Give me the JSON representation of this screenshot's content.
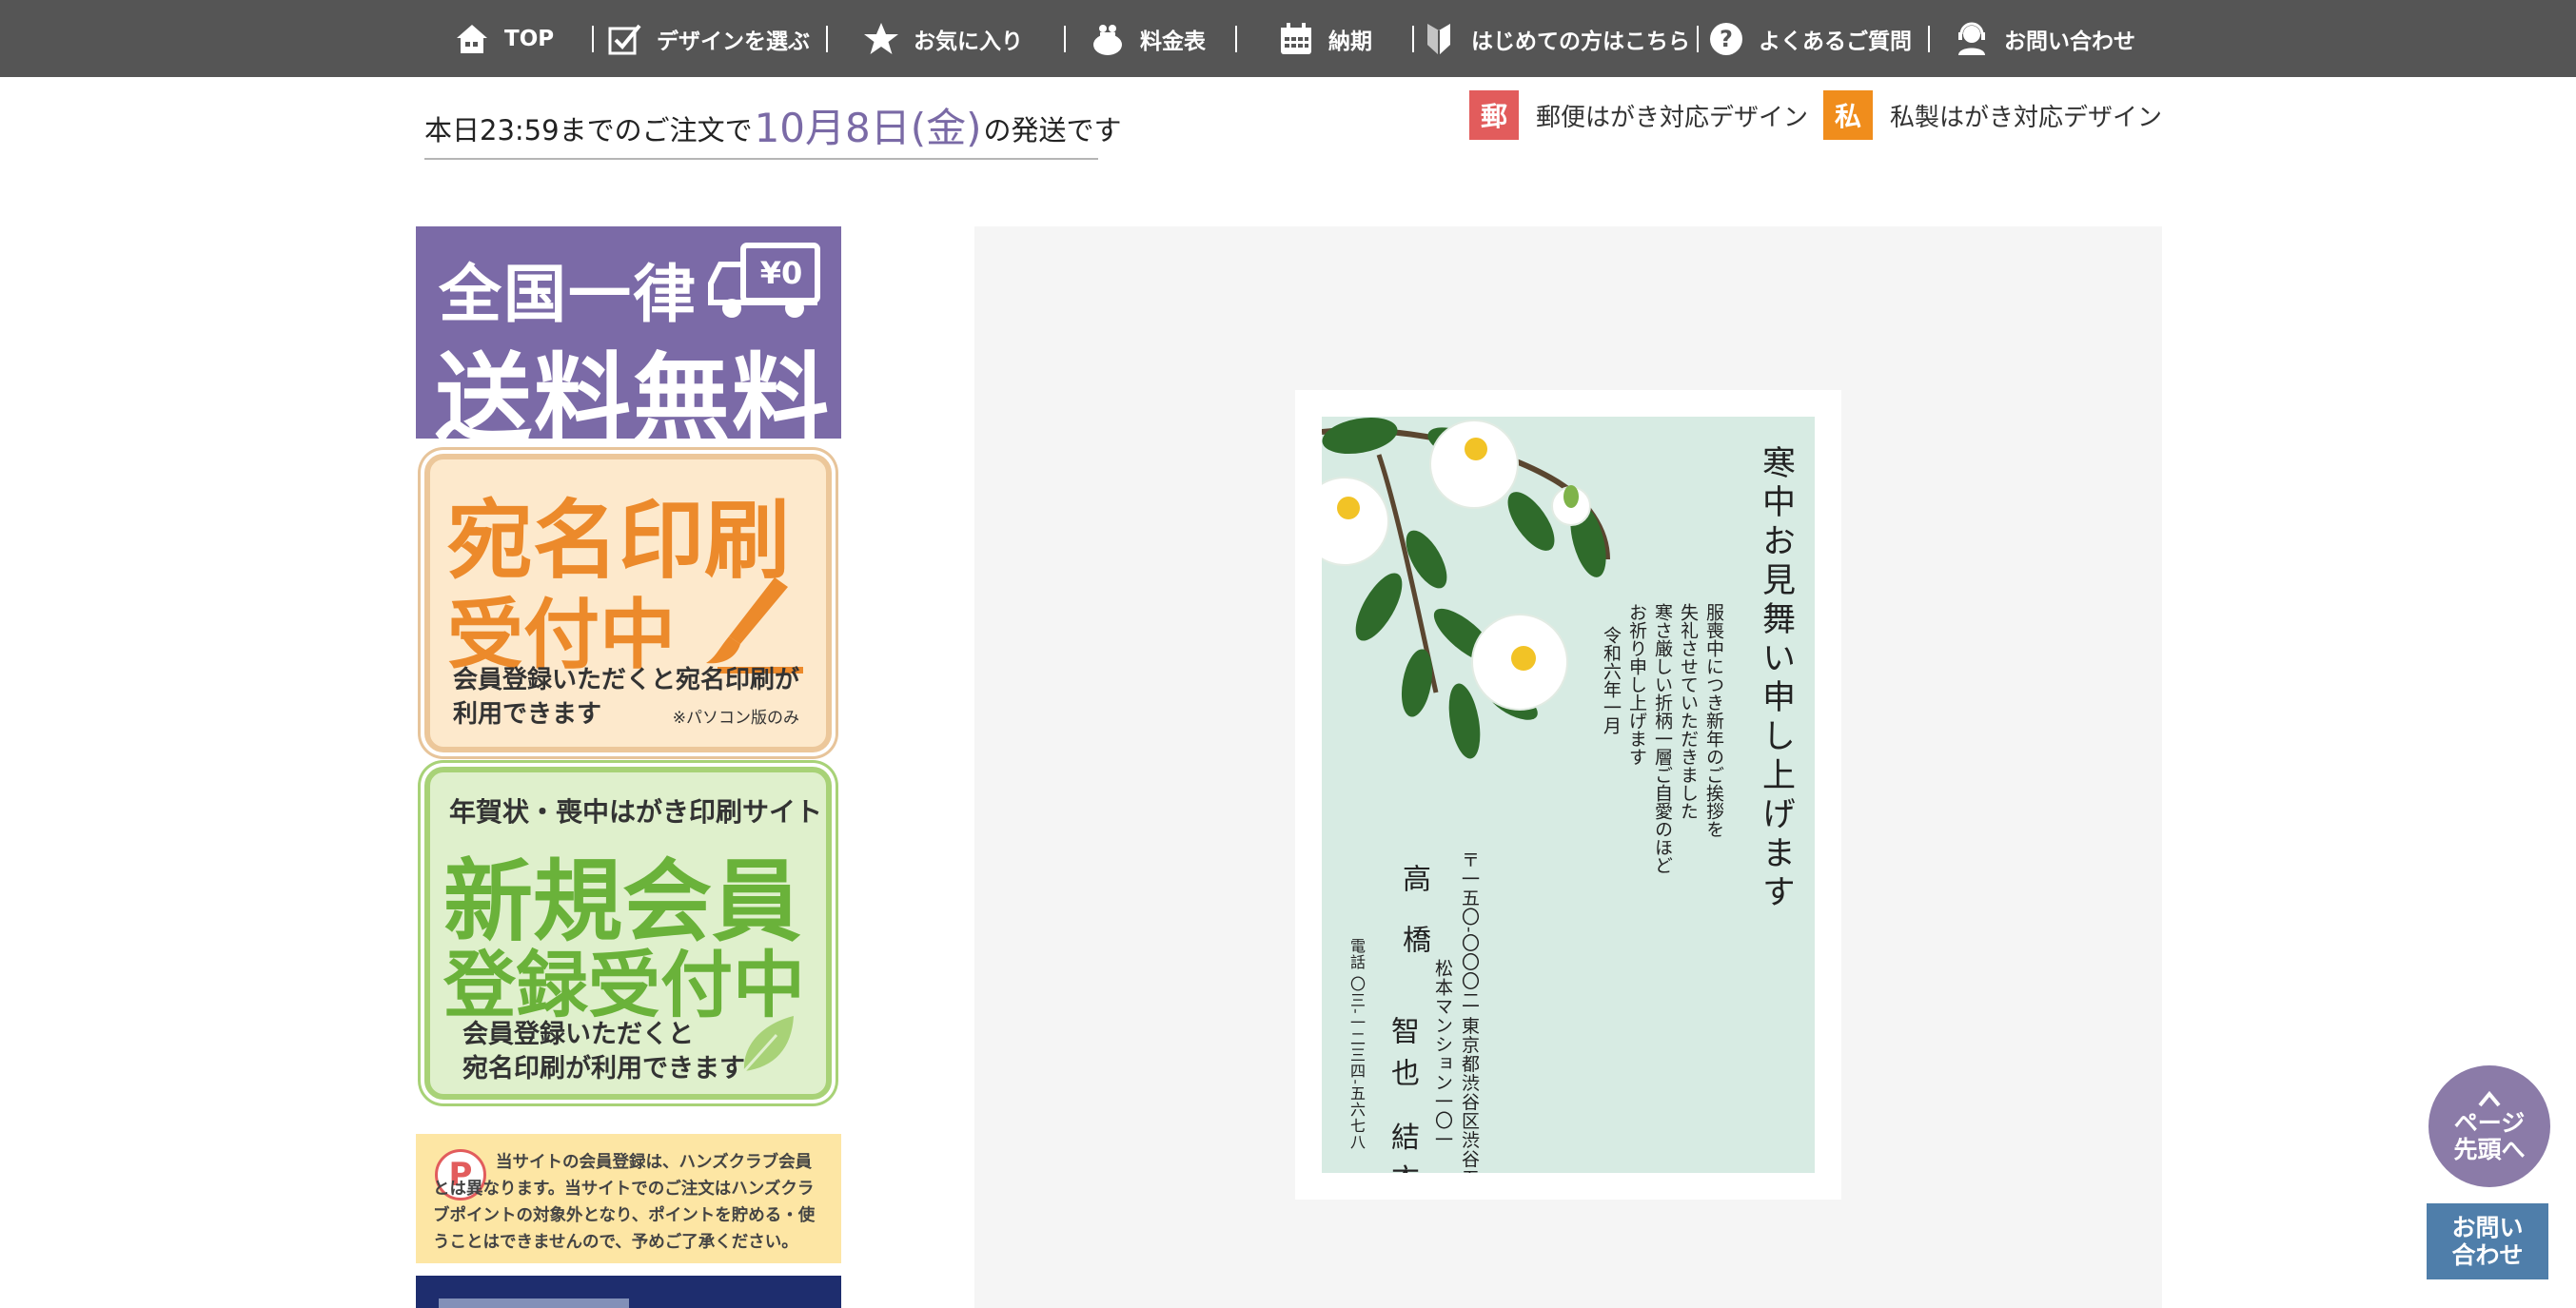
{
  "nav": {
    "items": [
      {
        "label": "TOP",
        "icon": "home-icon"
      },
      {
        "label": "デザインを選ぶ",
        "icon": "checkbox-icon"
      },
      {
        "label": "お気に入り",
        "icon": "star-icon"
      },
      {
        "label": "料金表",
        "icon": "coin-purse-icon"
      },
      {
        "label": "納期",
        "icon": "calendar-icon"
      },
      {
        "label": "はじめての方はこちら",
        "icon": "beginner-mark-icon"
      },
      {
        "label": "よくあるご質問",
        "icon": "question-icon"
      },
      {
        "label": "お問い合わせ",
        "icon": "support-operator-icon"
      }
    ],
    "separator": "|"
  },
  "shipping": {
    "prefix": "本日23:59までのご注文で",
    "date": "10月8日(金)",
    "suffix": "の発送です"
  },
  "legend": {
    "post_badge": "郵",
    "post_label": "郵便はがき対応デザイン",
    "post_color": "#e25c5c",
    "private_badge": "私",
    "private_label": "私製はがき対応デザイン",
    "private_color": "#f08d1c"
  },
  "banners": {
    "free_shipping": {
      "line1": "全国一律",
      "line2": "送料無料",
      "price": "¥0"
    },
    "address_print": {
      "line1": "宛名印刷",
      "line2": "受付中",
      "desc1": "会員登録いただくと宛名印刷が",
      "desc2": "利用できます",
      "note": "※パソコン版のみ"
    },
    "new_member": {
      "top": "年賀状・喪中はがき印刷サイト",
      "line1": "新規会員",
      "line2": "登録受付中",
      "desc1": "会員登録いただくと",
      "desc2": "宛名印刷が利用できます"
    },
    "notice": {
      "icon_letter": "P",
      "text": "当サイトの会員登録は、ハンズクラブ会員とは異なります。当サイトでのご注文はハンズクラブポイントの対象外となり、ポイントを貯める・使うことはできませんので、予めご了承ください。"
    }
  },
  "card": {
    "greeting": "寒中お見舞い申し上げます",
    "body": [
      "服喪中につき新年のご挨拶を",
      "失礼させていただきました",
      "寒さ厳しい折柄一層ご自愛のほど",
      "お祈り申し上げます",
      "令和六年一月"
    ],
    "address1": "〒一五〇-〇〇〇二 東京都渋谷区渋谷五-二五-二〇三",
    "address2": "松本マンション一〇一",
    "name_family": "高橋",
    "name_given": "智也 結衣",
    "tel": "電話 〇三-一二三四-五六七八",
    "background": "#d7ebe3"
  },
  "float": {
    "top_line1": "ページ",
    "top_line2": "先頭へ",
    "contact_line1": "お問い",
    "contact_line2": "合わせ"
  }
}
